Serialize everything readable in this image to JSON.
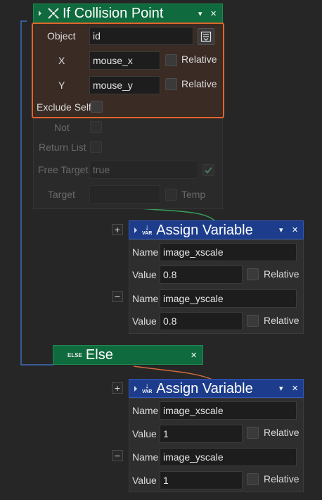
{
  "colors": {
    "green_header": "#0f6b3e",
    "blue_header": "#1d3d8c",
    "highlight_border": "#e0662a",
    "wire_blue": "#3e6fb8",
    "wire_green": "#3aa05a",
    "wire_orange": "#d06a3a"
  },
  "collision_node": {
    "icon": "collision-point-icon",
    "title": "If Collision Point",
    "fields": {
      "object_label": "Object",
      "object_value": "id",
      "x_label": "X",
      "x_value": "mouse_x",
      "y_label": "Y",
      "y_value": "mouse_y",
      "relative_label": "Relative",
      "exclude_self_label": "Exclude Self",
      "not_label": "Not",
      "return_list_label": "Return List",
      "free_target_label": "Free Target",
      "free_target_value": "true",
      "target_label": "Target",
      "temp_label": "Temp"
    }
  },
  "assign1": {
    "icon_text": "VAR",
    "title": "Assign Variable",
    "rows": [
      {
        "name_label": "Name",
        "name_value": "image_xscale",
        "value_label": "Value",
        "value": "0.8",
        "relative_label": "Relative"
      },
      {
        "name_label": "Name",
        "name_value": "image_yscale",
        "value_label": "Value",
        "value": "0.8",
        "relative_label": "Relative"
      }
    ]
  },
  "else_node": {
    "icon_text": "ELSE",
    "title": "Else"
  },
  "assign2": {
    "icon_text": "VAR",
    "title": "Assign Variable",
    "rows": [
      {
        "name_label": "Name",
        "name_value": "image_xscale",
        "value_label": "Value",
        "value": "1",
        "relative_label": "Relative"
      },
      {
        "name_label": "Name",
        "name_value": "image_yscale",
        "value_label": "Value",
        "value": "1",
        "relative_label": "Relative"
      }
    ]
  },
  "controls": {
    "plus": "+",
    "minus": "−",
    "close": "✕",
    "dropdown": "▾"
  }
}
